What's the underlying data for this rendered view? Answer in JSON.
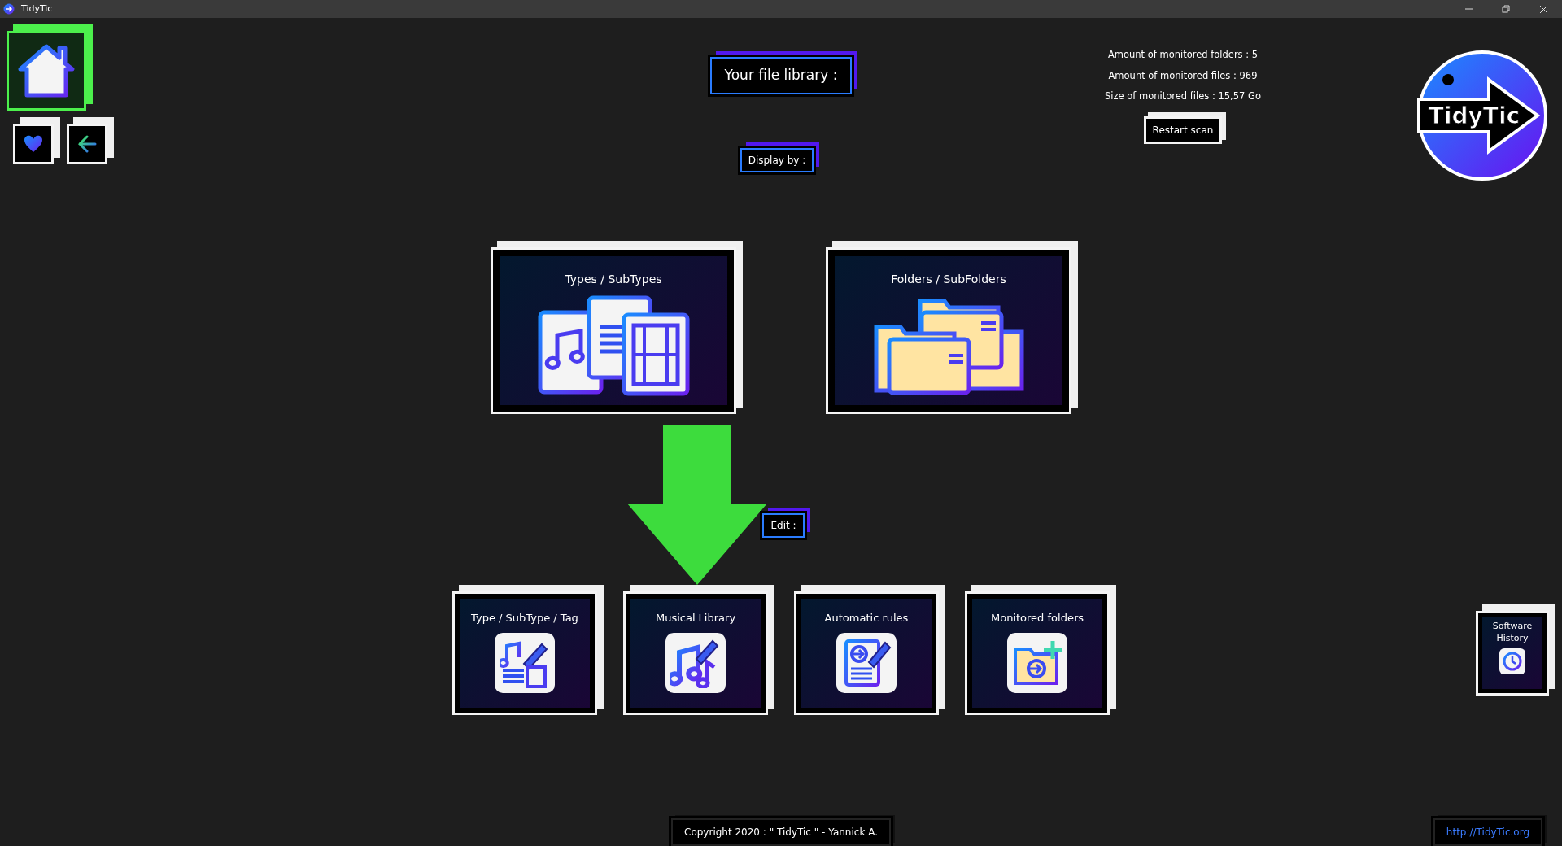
{
  "window": {
    "title": "TidyTic"
  },
  "nav_buttons": [
    {
      "kind": "home",
      "selected": true
    },
    {
      "kind": "favorites",
      "selected": false
    },
    {
      "kind": "back",
      "selected": false
    }
  ],
  "header": {
    "title": "Your file library :"
  },
  "stats": [
    "Amount of monitored folders : 5",
    "Amount of monitored files : 969",
    "Size of monitored files : 15,57 Go"
  ],
  "restart_button": "Restart scan",
  "logo": {
    "text": "TidyTic"
  },
  "display_by": {
    "label": "Display by :",
    "options": [
      {
        "label": "Types / SubTypes",
        "kind": "types"
      },
      {
        "label": "Folders / SubFolders",
        "kind": "folders"
      }
    ]
  },
  "edit": {
    "label": "Edit :",
    "options": [
      {
        "label": "Type / SubType / Tag",
        "kind": "tags"
      },
      {
        "label": "Musical Library",
        "kind": "music"
      },
      {
        "label": "Automatic rules",
        "kind": "rules"
      },
      {
        "label": "Monitored folders",
        "kind": "monitored"
      }
    ]
  },
  "history_button": "Software History",
  "footer": {
    "copyright": "Copyright 2020 : \" TidyTic \" - Yannick A.",
    "link": "http://TidyTic.org"
  }
}
